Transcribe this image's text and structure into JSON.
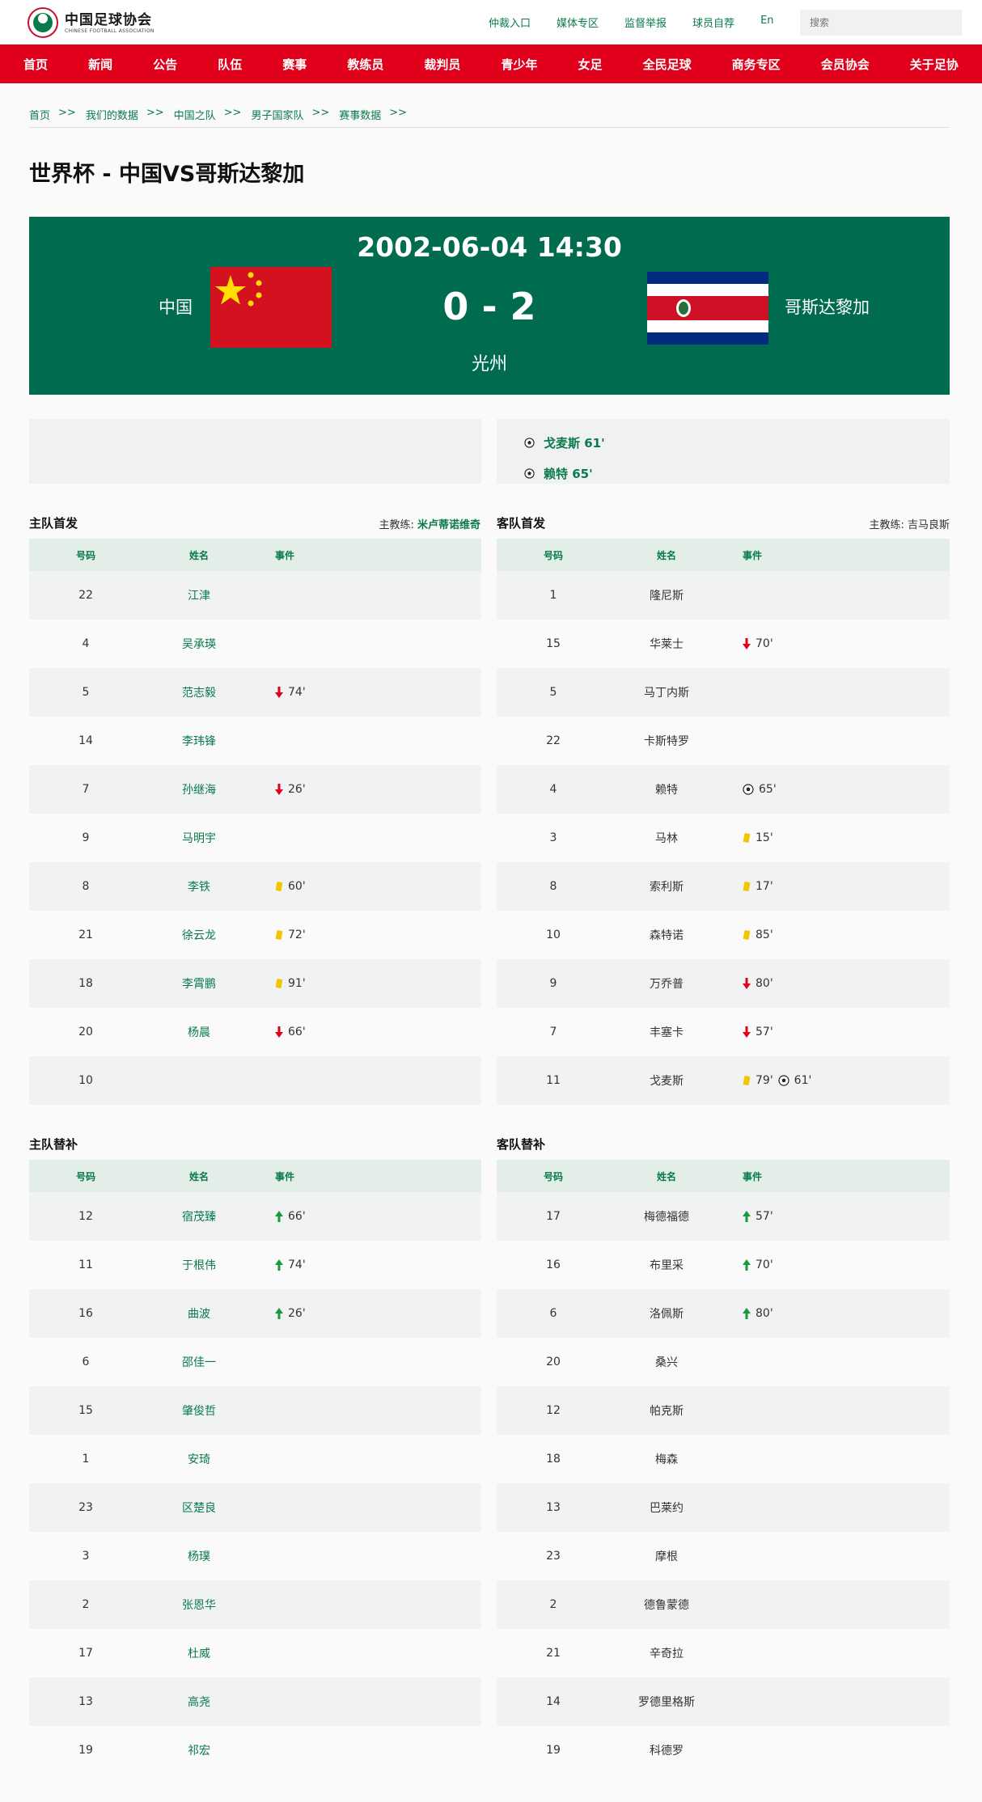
{
  "header": {
    "logo_cn": "中国足球协会",
    "logo_en": "CHINESE FOOTBALL ASSOCIATION",
    "links": [
      "仲裁入口",
      "媒体专区",
      "监督举报",
      "球员自荐",
      "En"
    ],
    "search_placeholder": "搜索"
  },
  "nav": [
    "首页",
    "新闻",
    "公告",
    "队伍",
    "赛事",
    "教练员",
    "裁判员",
    "青少年",
    "女足",
    "全民足球",
    "商务专区",
    "会员协会",
    "关于足协"
  ],
  "breadcrumb": [
    "首页",
    "我们的数据",
    "中国之队",
    "男子国家队",
    "赛事数据"
  ],
  "breadcrumb_sep": ">>",
  "title": "世界杯 - 中国VS哥斯达黎加",
  "match": {
    "datetime": "2002-06-04 14:30",
    "home": "中国",
    "away": "哥斯达黎加",
    "score": "0 - 2",
    "venue": "光州"
  },
  "away_goals": [
    "戈麦斯 61'",
    "赖特 65'"
  ],
  "home_starting": {
    "title": "主队首发",
    "coach_label": "主教练:",
    "coach": "米卢蒂诺维奇",
    "headers": [
      "号码",
      "姓名",
      "事件"
    ],
    "rows": [
      {
        "num": "22",
        "name": "江津",
        "events": []
      },
      {
        "num": "4",
        "name": "吴承瑛",
        "events": []
      },
      {
        "num": "5",
        "name": "范志毅",
        "events": [
          {
            "type": "out",
            "min": "74'"
          }
        ]
      },
      {
        "num": "14",
        "name": "李玮锋",
        "events": []
      },
      {
        "num": "7",
        "name": "孙继海",
        "events": [
          {
            "type": "out",
            "min": "26'"
          }
        ]
      },
      {
        "num": "9",
        "name": "马明宇",
        "events": []
      },
      {
        "num": "8",
        "name": "李铁",
        "events": [
          {
            "type": "yellow",
            "min": "60'"
          }
        ]
      },
      {
        "num": "21",
        "name": "徐云龙",
        "events": [
          {
            "type": "yellow",
            "min": "72'"
          }
        ]
      },
      {
        "num": "18",
        "name": "李霄鹏",
        "events": [
          {
            "type": "yellow",
            "min": "91'"
          }
        ]
      },
      {
        "num": "20",
        "name": "杨晨",
        "events": [
          {
            "type": "out",
            "min": "66'"
          }
        ]
      },
      {
        "num": "10",
        "name": "",
        "events": []
      }
    ]
  },
  "away_starting": {
    "title": "客队首发",
    "coach_label": "主教练:",
    "coach": "吉马良斯",
    "headers": [
      "号码",
      "姓名",
      "事件"
    ],
    "rows": [
      {
        "num": "1",
        "name": "隆尼斯",
        "events": []
      },
      {
        "num": "15",
        "name": "华莱士",
        "events": [
          {
            "type": "out",
            "min": "70'"
          }
        ]
      },
      {
        "num": "5",
        "name": "马丁内斯",
        "events": []
      },
      {
        "num": "22",
        "name": "卡斯特罗",
        "events": []
      },
      {
        "num": "4",
        "name": "赖特",
        "events": [
          {
            "type": "goal",
            "min": "65'"
          }
        ]
      },
      {
        "num": "3",
        "name": "马林",
        "events": [
          {
            "type": "yellow",
            "min": "15'"
          }
        ]
      },
      {
        "num": "8",
        "name": "索利斯",
        "events": [
          {
            "type": "yellow",
            "min": "17'"
          }
        ]
      },
      {
        "num": "10",
        "name": "森特诺",
        "events": [
          {
            "type": "yellow",
            "min": "85'"
          }
        ]
      },
      {
        "num": "9",
        "name": "万乔普",
        "events": [
          {
            "type": "out",
            "min": "80'"
          }
        ]
      },
      {
        "num": "7",
        "name": "丰塞卡",
        "events": [
          {
            "type": "out",
            "min": "57'"
          }
        ]
      },
      {
        "num": "11",
        "name": "戈麦斯",
        "events": [
          {
            "type": "yellow",
            "min": "79'"
          },
          {
            "type": "goal",
            "min": "61'"
          }
        ]
      }
    ]
  },
  "home_subs": {
    "title": "主队替补",
    "headers": [
      "号码",
      "姓名",
      "事件"
    ],
    "rows": [
      {
        "num": "12",
        "name": "宿茂臻",
        "events": [
          {
            "type": "in",
            "min": "66'"
          }
        ]
      },
      {
        "num": "11",
        "name": "于根伟",
        "events": [
          {
            "type": "in",
            "min": "74'"
          }
        ]
      },
      {
        "num": "16",
        "name": "曲波",
        "events": [
          {
            "type": "in",
            "min": "26'"
          }
        ]
      },
      {
        "num": "6",
        "name": "邵佳一",
        "events": []
      },
      {
        "num": "15",
        "name": "肇俊哲",
        "events": []
      },
      {
        "num": "1",
        "name": "安琦",
        "events": []
      },
      {
        "num": "23",
        "name": "区楚良",
        "events": []
      },
      {
        "num": "3",
        "name": "杨璞",
        "events": []
      },
      {
        "num": "2",
        "name": "张恩华",
        "events": []
      },
      {
        "num": "17",
        "name": "杜威",
        "events": []
      },
      {
        "num": "13",
        "name": "高尧",
        "events": []
      },
      {
        "num": "19",
        "name": "祁宏",
        "events": []
      }
    ]
  },
  "away_subs": {
    "title": "客队替补",
    "headers": [
      "号码",
      "姓名",
      "事件"
    ],
    "rows": [
      {
        "num": "17",
        "name": "梅德福德",
        "events": [
          {
            "type": "in",
            "min": "57'"
          }
        ]
      },
      {
        "num": "16",
        "name": "布里采",
        "events": [
          {
            "type": "in",
            "min": "70'"
          }
        ]
      },
      {
        "num": "6",
        "name": "洛佩斯",
        "events": [
          {
            "type": "in",
            "min": "80'"
          }
        ]
      },
      {
        "num": "20",
        "name": "桑兴",
        "events": []
      },
      {
        "num": "12",
        "name": "帕克斯",
        "events": []
      },
      {
        "num": "18",
        "name": "梅森",
        "events": []
      },
      {
        "num": "13",
        "name": "巴莱约",
        "events": []
      },
      {
        "num": "23",
        "name": "摩根",
        "events": []
      },
      {
        "num": "2",
        "name": "德鲁蒙德",
        "events": []
      },
      {
        "num": "21",
        "name": "辛奇拉",
        "events": []
      },
      {
        "num": "14",
        "name": "罗德里格斯",
        "events": []
      },
      {
        "num": "19",
        "name": "科德罗",
        "events": []
      }
    ]
  },
  "colors": {
    "brand_red": "#e0001b",
    "panel_green": "#006b4f",
    "link_green": "#0a7a4a"
  },
  "event_icons": {
    "goal": "soccer-ball-icon",
    "yellow": "yellow-card-icon",
    "out": "sub-out-arrow-icon",
    "in": "sub-in-arrow-icon"
  }
}
